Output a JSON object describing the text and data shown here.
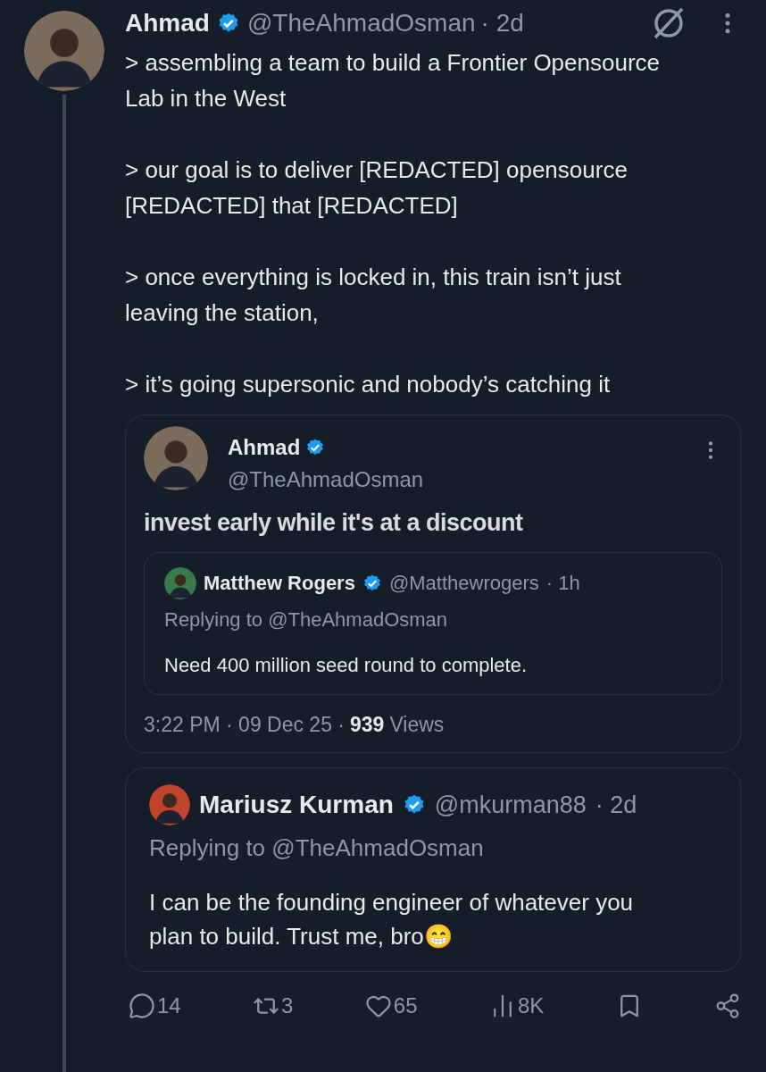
{
  "post": {
    "author": {
      "name": "Ahmad",
      "verified": true,
      "handle": "@TheAhmadOsman",
      "time": "· 2d"
    },
    "paragraphs": [
      "> assembling a team to build a Frontier Opensource Lab in the West",
      "> our goal is to deliver [REDACTED] opensource [REDACTED] that [REDACTED]",
      "> once everything is locked in, this train isn’t just leaving the station,",
      "> it’s going supersonic and nobody’s catching it"
    ],
    "quote": {
      "author": {
        "name": "Ahmad",
        "verified": true,
        "handle": "@TheAhmadOsman"
      },
      "text": "invest early while it's at a discount",
      "inner": {
        "author": {
          "name": "Matthew Rogers",
          "verified": true,
          "handle": "@Matthewrogers",
          "time": "· 1h"
        },
        "replying": "Replying to @TheAhmadOsman",
        "text": "Need 400 million seed round to complete."
      },
      "time": "3:22 PM · 09 Dec 25 ·",
      "views_count": "939",
      "views_label": "Views"
    },
    "reply": {
      "author": {
        "name": "Mariusz Kurman",
        "verified": true,
        "handle": "@mkurman88",
        "time": "· 2d"
      },
      "replying": "Replying to @TheAhmadOsman",
      "text": "I can be the founding engineer of whatever you plan to build. Trust me, bro😁"
    },
    "actions": [
      {
        "kind": "reply",
        "count": "14"
      },
      {
        "kind": "repost",
        "count": "3"
      },
      {
        "kind": "like",
        "count": "65"
      },
      {
        "kind": "views",
        "count": "8K"
      },
      {
        "kind": "bookmark"
      },
      {
        "kind": "share"
      }
    ]
  }
}
